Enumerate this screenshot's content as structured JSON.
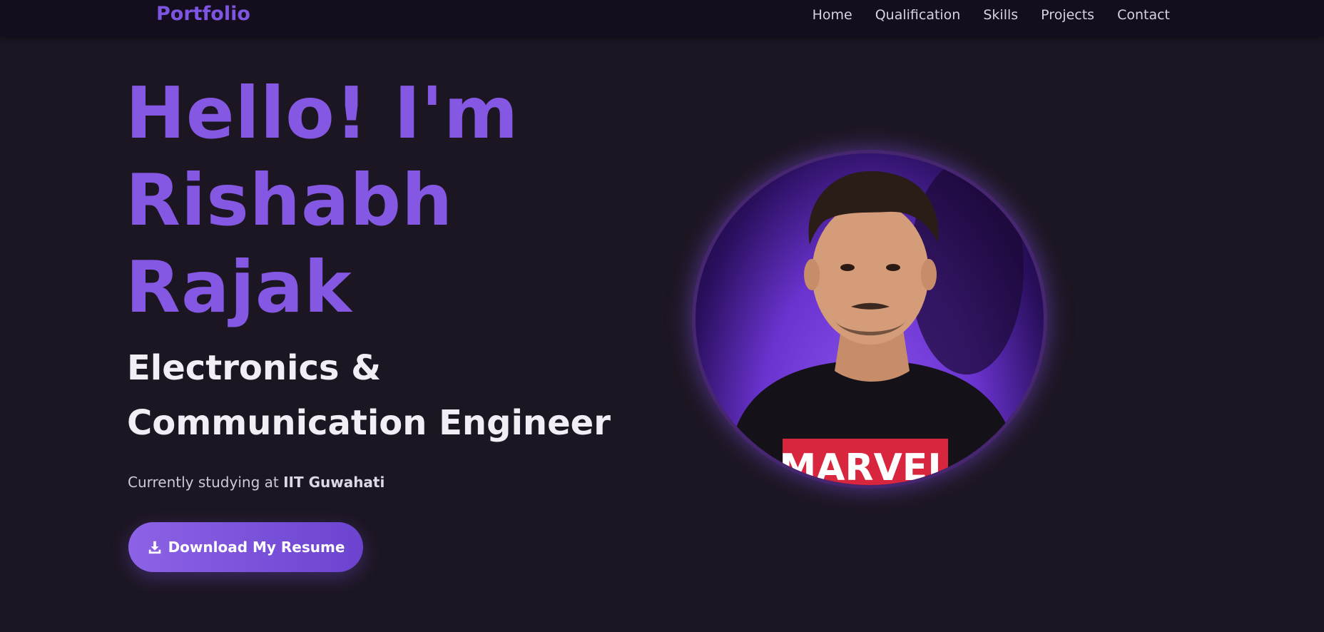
{
  "nav": {
    "brand": "Portfolio",
    "links": [
      "Home",
      "Qualification",
      "Skills",
      "Projects",
      "Contact"
    ]
  },
  "hero": {
    "title_lines": [
      "Hello! I'm",
      "Rishabh",
      "Rajak"
    ],
    "subtitle_lines": [
      "Electronics &",
      "Communication Engineer"
    ],
    "study_prefix": "Currently studying at ",
    "study_institute": "IIT Guwahati",
    "resume_button": "Download My Resume",
    "resume_icon": "download-icon",
    "photo_text": "MARVEL"
  },
  "colors": {
    "background": "#1c1622",
    "navbar": "#130d1d",
    "accent": "#8458e3",
    "button_start": "#8d62e6",
    "button_end": "#6b43cf"
  }
}
